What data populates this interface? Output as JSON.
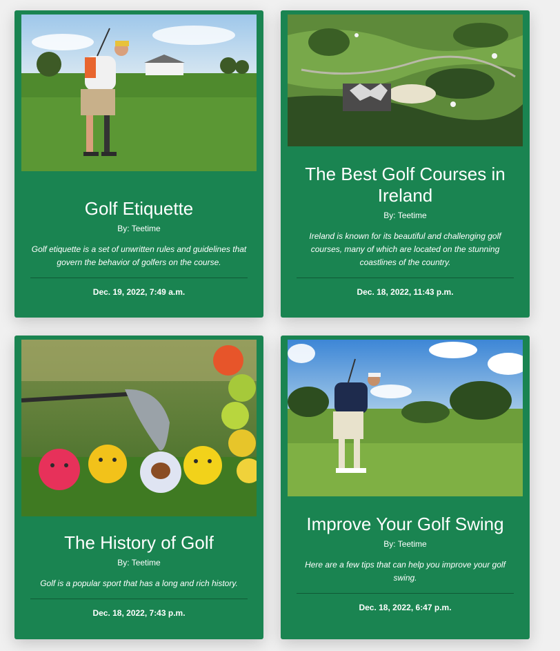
{
  "posts": [
    {
      "title": "Golf Etiquette",
      "author": "By: Teetime",
      "excerpt": "Golf etiquette is a set of unwritten rules and guidelines that govern the behavior of golfers on the course.",
      "date": "Dec. 19, 2022, 7:49 a.m.",
      "image": "golfer-swing-photo"
    },
    {
      "title": "The Best Golf Courses in Ireland",
      "author": "By: Teetime",
      "excerpt": "Ireland is known for its beautiful and challenging golf courses, many of which are located on the stunning coastlines of the country.",
      "date": "Dec. 18, 2022, 11:43 p.m.",
      "image": "aerial-golf-course-photo"
    },
    {
      "title": "The History of Golf",
      "author": "By: Teetime",
      "excerpt": "Golf is a popular sport that has a long and rich history.",
      "date": "Dec. 18, 2022, 7:43 p.m.",
      "image": "golf-balls-club-photo"
    },
    {
      "title": "Improve Your Golf Swing",
      "author": "By: Teetime",
      "excerpt": "Here are a few tips that can help you improve your golf swing.",
      "date": "Dec. 18, 2022, 6:47 p.m.",
      "image": "golfer-follow-through-photo"
    }
  ],
  "colors": {
    "card_bg": "#1a8451",
    "page_bg": "#f0f0f0",
    "text": "#ffffff",
    "divider": "#0f5a35"
  }
}
